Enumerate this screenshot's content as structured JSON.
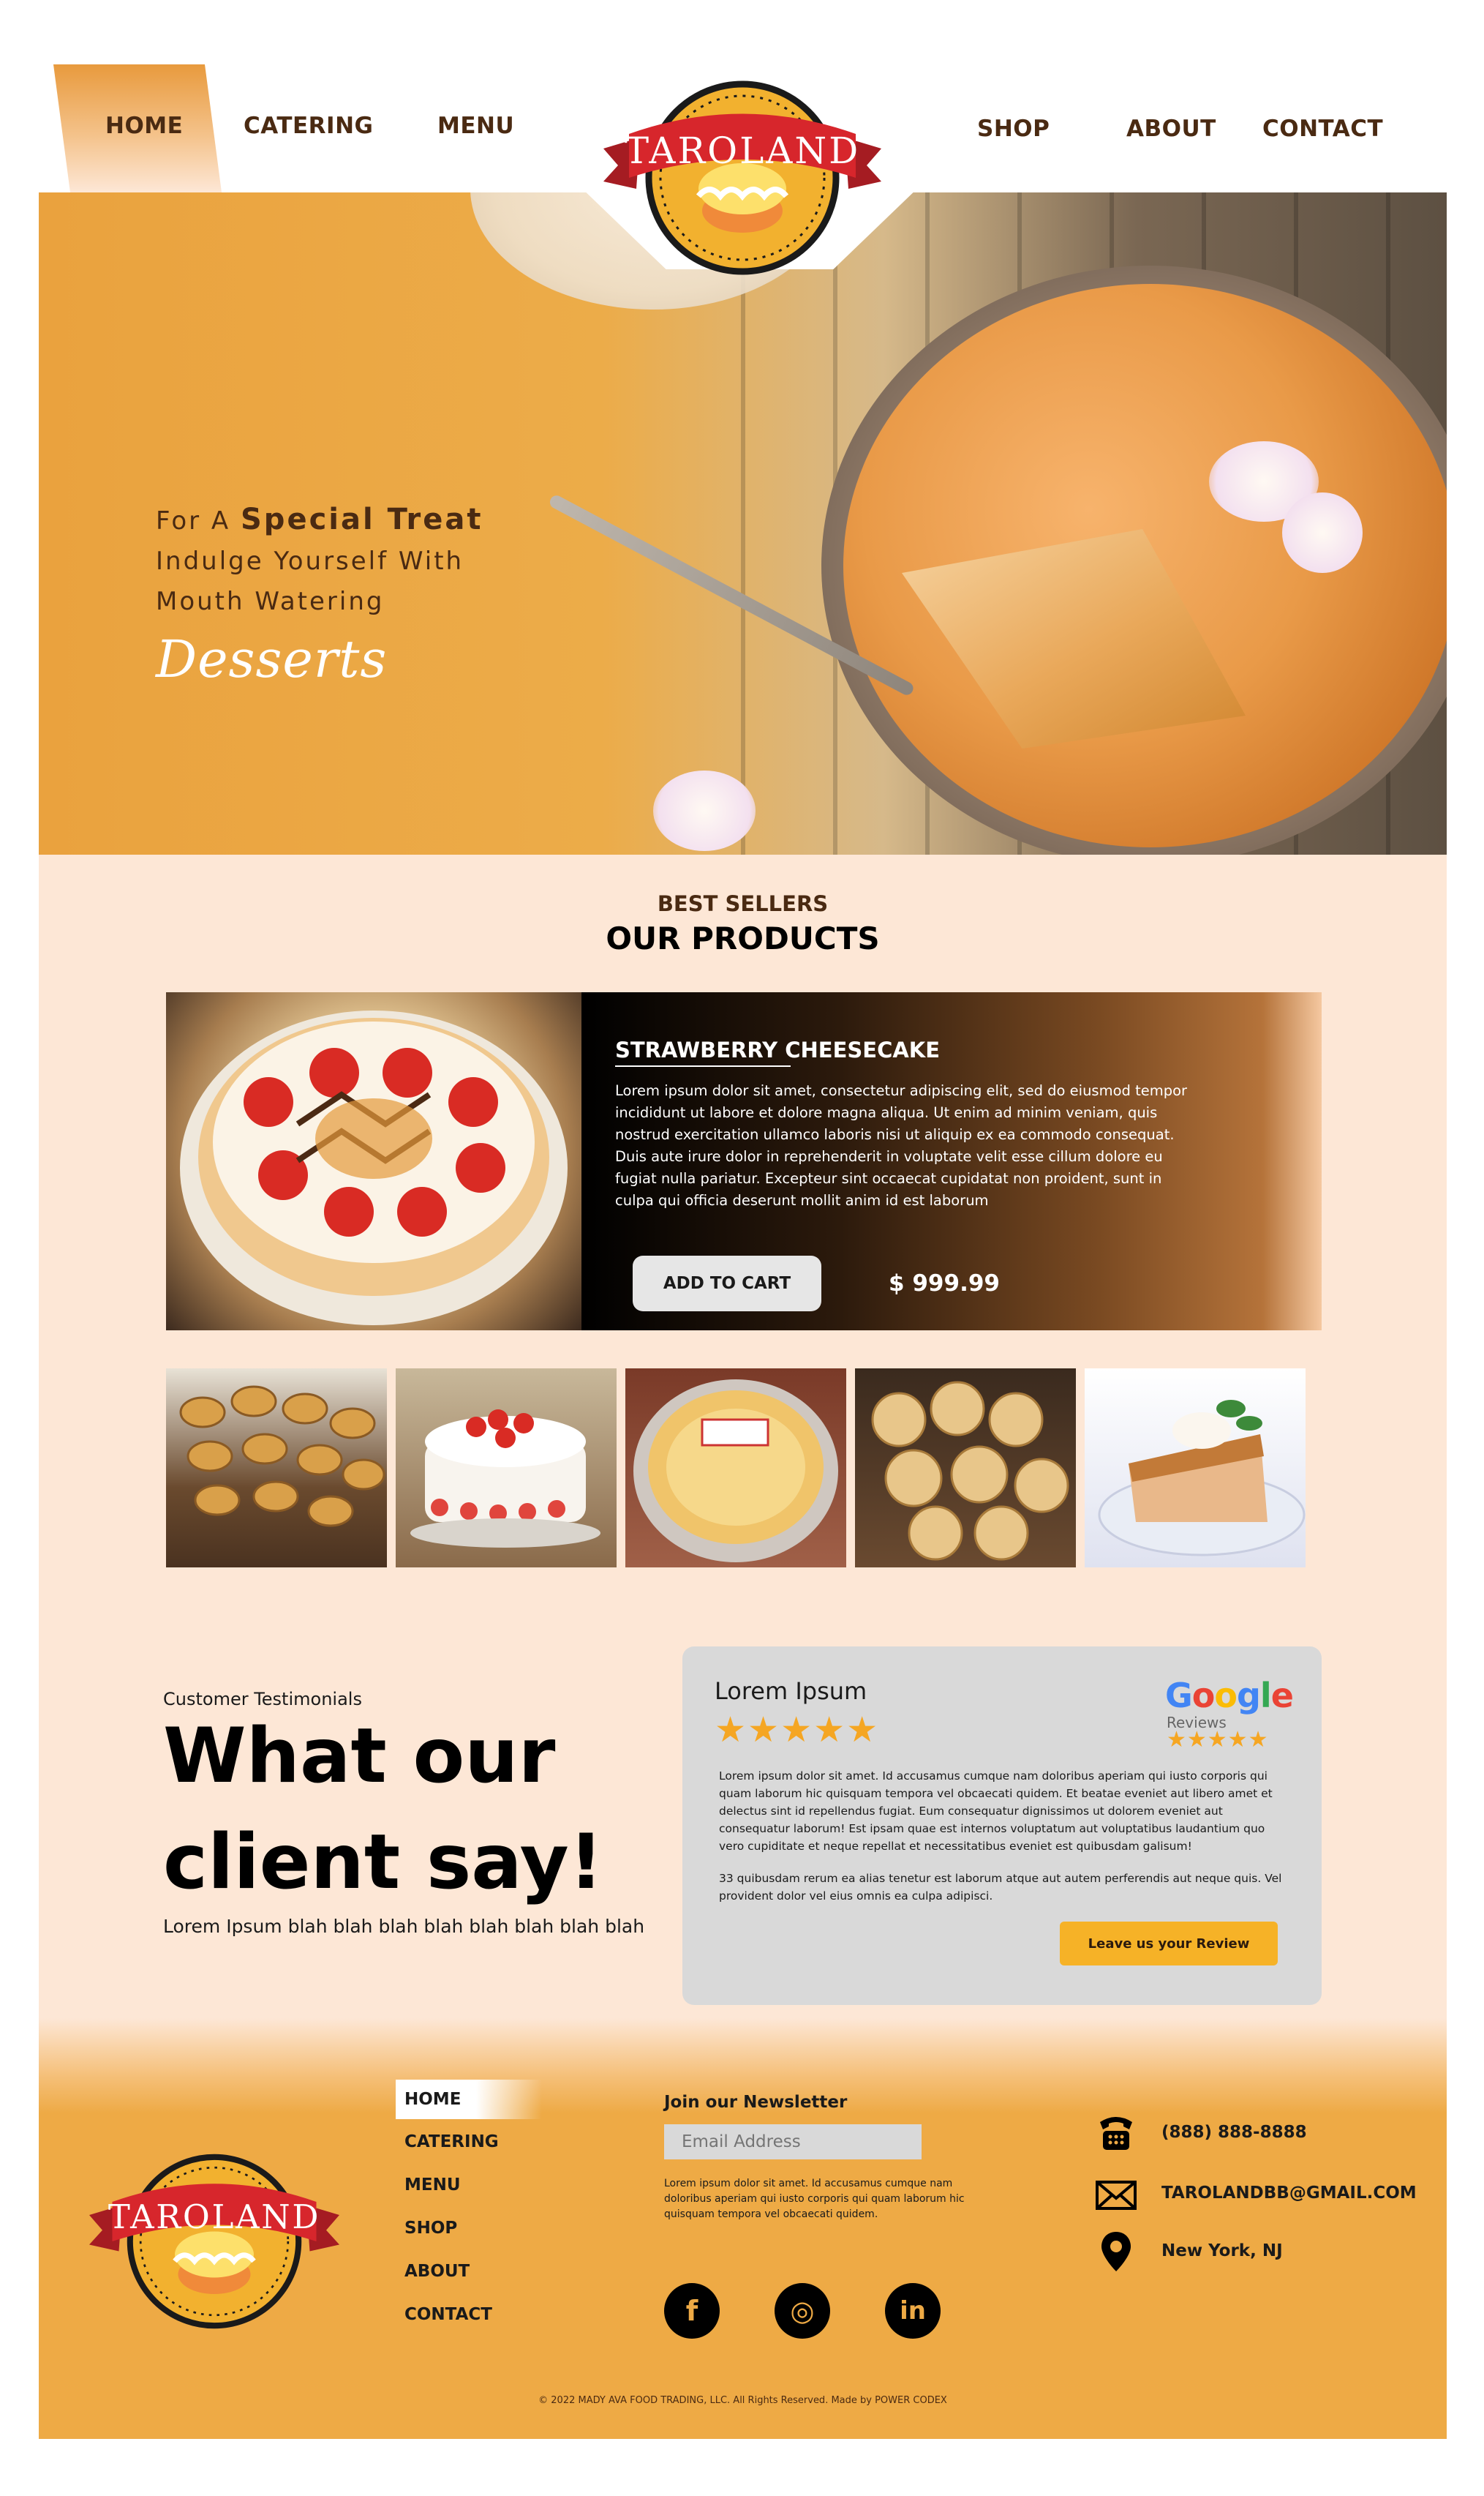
{
  "nav": {
    "home": "HOME",
    "catering": "CATERING",
    "menu": "MENU",
    "shop": "SHOP",
    "about": "ABOUT",
    "contact": "CONTACT"
  },
  "logo": {
    "text": "TAROLAND"
  },
  "hero": {
    "line1_prefix": "For A ",
    "line1_bold": "Special Treat",
    "line2": "Indulge Yourself With",
    "line3": "Mouth Watering",
    "script": "Desserts"
  },
  "products": {
    "kicker": "BEST SELLERS",
    "heading": "OUR PRODUCTS",
    "featured": {
      "title": "STRAWBERRY CHEESECAKE",
      "description": "Lorem ipsum dolor sit amet, consectetur adipiscing elit, sed do eiusmod tempor incididunt ut labore et dolore magna aliqua. Ut enim ad minim veniam, quis nostrud exercitation ullamco laboris nisi ut aliquip ex ea commodo consequat. Duis aute irure dolor in reprehenderit in voluptate velit esse cillum dolore eu fugiat nulla pariatur. Excepteur sint occaecat cupidatat non proident, sunt in culpa qui officia deserunt mollit anim id est laborum",
      "add_to_cart": "ADD TO CART",
      "price": "$ 999.99"
    }
  },
  "testimonials": {
    "label": "Customer Testimonials",
    "heading_line1": "What our",
    "heading_line2": "client say!",
    "sub": "Lorem Ipsum blah blah blah blah blah blah blah blah",
    "review": {
      "name": "Lorem Ipsum",
      "stars": "★★★★★",
      "google": "Google",
      "google_reviews": "Reviews",
      "google_stars": "★★★★★",
      "body1": "Lorem ipsum dolor sit amet. Id accusamus cumque nam doloribus aperiam qui iusto corporis qui quam laborum hic quisquam tempora vel obcaecati quidem. Et beatae eveniet aut libero amet et delectus sint id repellendus fugiat. Eum consequatur dignissimos ut dolorem eveniet aut consequatur laborum! Est ipsam quae est internos voluptatum aut voluptatibus laudantium quo vero cupiditate et neque repellat et necessitatibus eveniet est quibusdam galisum!",
      "body2": "33 quibusdam rerum ea alias tenetur est laborum atque aut autem perferendis aut neque quis. Vel provident dolor vel eius omnis ea culpa adipisci.",
      "button": "Leave us your Review"
    }
  },
  "footer": {
    "links": [
      "HOME",
      "CATERING",
      "MENU",
      "SHOP",
      "ABOUT",
      "CONTACT"
    ],
    "newsletter_title": "Join our Newsletter",
    "email_placeholder": "Email Address",
    "newsletter_text": "Lorem ipsum dolor sit amet. Id accusamus cumque nam doloribus aperiam qui iusto corporis qui quam laborum hic quisquam tempora vel obcaecati quidem.",
    "phone": "(888) 888-8888",
    "email": "TAROLANDBB@GMAIL.COM",
    "location": "New York, NJ",
    "copyright": "© 2022 MADY AVA FOOD TRADING, LLC. All Rights Reserved. Made by POWER CODEX",
    "social": {
      "facebook": "f",
      "instagram": "◎",
      "linkedin": "in"
    }
  },
  "colors": {
    "accent": "#eeaa45",
    "brown": "#4a2a12",
    "cream": "#fde7d6",
    "logo_red": "#d7262c",
    "button_yellow": "#f6b227"
  },
  "icons": {
    "phone": "phone-icon",
    "mail": "mail-icon",
    "location": "location-pin-icon",
    "facebook": "facebook-icon",
    "instagram": "instagram-icon",
    "linkedin": "linkedin-icon"
  }
}
